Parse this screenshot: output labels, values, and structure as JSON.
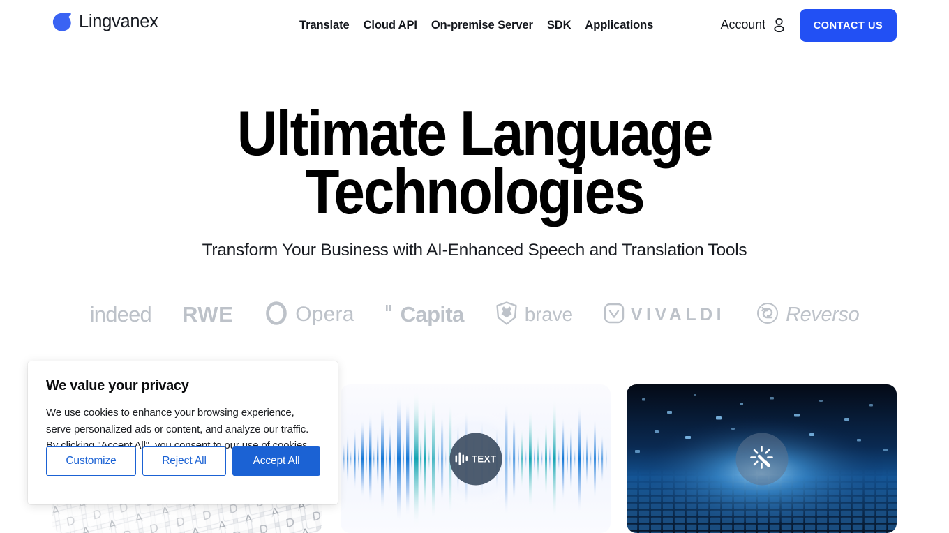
{
  "header": {
    "logo": {
      "icon": "lingvanex-drop-icon",
      "text": "Lingvanex",
      "color": "#3A63F3"
    },
    "nav": [
      {
        "label": "Translate"
      },
      {
        "label": "Cloud API"
      },
      {
        "label": "On-premise Server"
      },
      {
        "label": "SDK"
      },
      {
        "label": "Applications"
      }
    ],
    "account": {
      "label": "Account",
      "icon": "user-account-icon"
    },
    "contact_button": {
      "label": "CONTACT US",
      "bg": "#2250F4",
      "color": "#FFFFFF"
    }
  },
  "hero": {
    "title_line1": "Ultimate Language",
    "title_line2": "Technologies",
    "subtitle": "Transform Your Business with AI-Enhanced Speech and Translation Tools"
  },
  "brands": {
    "color": "#BDC2C9",
    "items": [
      {
        "name": "indeed",
        "icon": "indeed-hook-icon"
      },
      {
        "name": "RWE",
        "icon": ""
      },
      {
        "name": "Opera",
        "icon": "opera-ring-icon"
      },
      {
        "name": "Capita",
        "icon": "capita-ticks-icon"
      },
      {
        "name": "brave",
        "icon": "brave-lion-shield-icon"
      },
      {
        "name": "VIVALDI",
        "icon": "vivaldi-square-icon"
      },
      {
        "name": "Reverso",
        "icon": "reverso-circular-arrow-icon"
      }
    ]
  },
  "cards": [
    {
      "id": "letter-tiles",
      "alt_name": "letter-tiles-card",
      "badge": null
    },
    {
      "id": "speech-to-text",
      "alt_name": "speech-waveform-card",
      "badge": {
        "icon": "audio-bars-icon",
        "label": "TEXT",
        "style": "dark"
      }
    },
    {
      "id": "ai-enhance",
      "alt_name": "ai-digital-grid-card",
      "badge": {
        "icon": "magic-wand-sparkle-icon",
        "label": "",
        "style": "glass"
      }
    }
  ],
  "cookie_banner": {
    "title": "We value your privacy",
    "body": "We use cookies to enhance your browsing experience, serve personalized ads or content, and analyze our traffic. By clicking \"Accept All\", you consent to our use of cookies.",
    "buttons": {
      "customize": "Customize",
      "reject": "Reject All",
      "accept": "Accept All"
    },
    "accent": "#1B62D4"
  }
}
